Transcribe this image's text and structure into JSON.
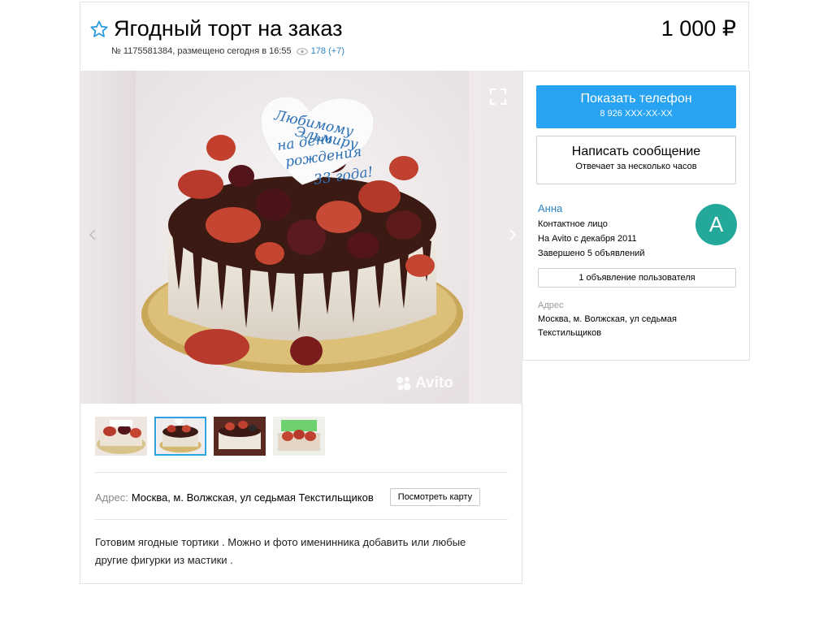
{
  "ad": {
    "title": "Ягодный торт на заказ",
    "price": "1 000 ₽",
    "meta_id": "№ 1175581384, размещено сегодня в 16:55",
    "views": "178 (+7)"
  },
  "gallery": {
    "watermark": "Avito",
    "cake_text": [
      "Любимому",
      "Эльмиру",
      "на день",
      "рождения",
      "33 года!"
    ],
    "thumbnails": [
      {
        "name": "thumb-1",
        "active": false
      },
      {
        "name": "thumb-2",
        "active": true
      },
      {
        "name": "thumb-3",
        "active": false
      },
      {
        "name": "thumb-4",
        "active": false
      }
    ]
  },
  "details": {
    "address_label": "Адрес:",
    "address_value": "Москва, м. Волжская, ул седьмая Текстильщиков",
    "map_button": "Посмотреть карту",
    "description": "Готовим ягодные тортики . Можно и фото именинника добавить или любые другие фигурки из мастики ."
  },
  "sidebar": {
    "phone_button": "Показать телефон",
    "phone_masked": "8 926 XXX-XX-XX",
    "message_button": "Написать сообщение",
    "message_sub": "Отвечает за несколько часов",
    "seller_name": "Анна",
    "seller_role": "Контактное лицо",
    "seller_since": "На Avito с декабря 2011",
    "seller_done": "Завершено 5 объявлений",
    "avatar_letter": "А",
    "ads_button": "1 объявление пользователя",
    "address_label": "Адрес",
    "address_line1": "Москва, м. Волжская, ул седьмая",
    "address_line2": "Текстильщиков"
  },
  "colors": {
    "accent": "#28a3f2",
    "link": "#2b84c4",
    "avatar": "#23a89a"
  }
}
